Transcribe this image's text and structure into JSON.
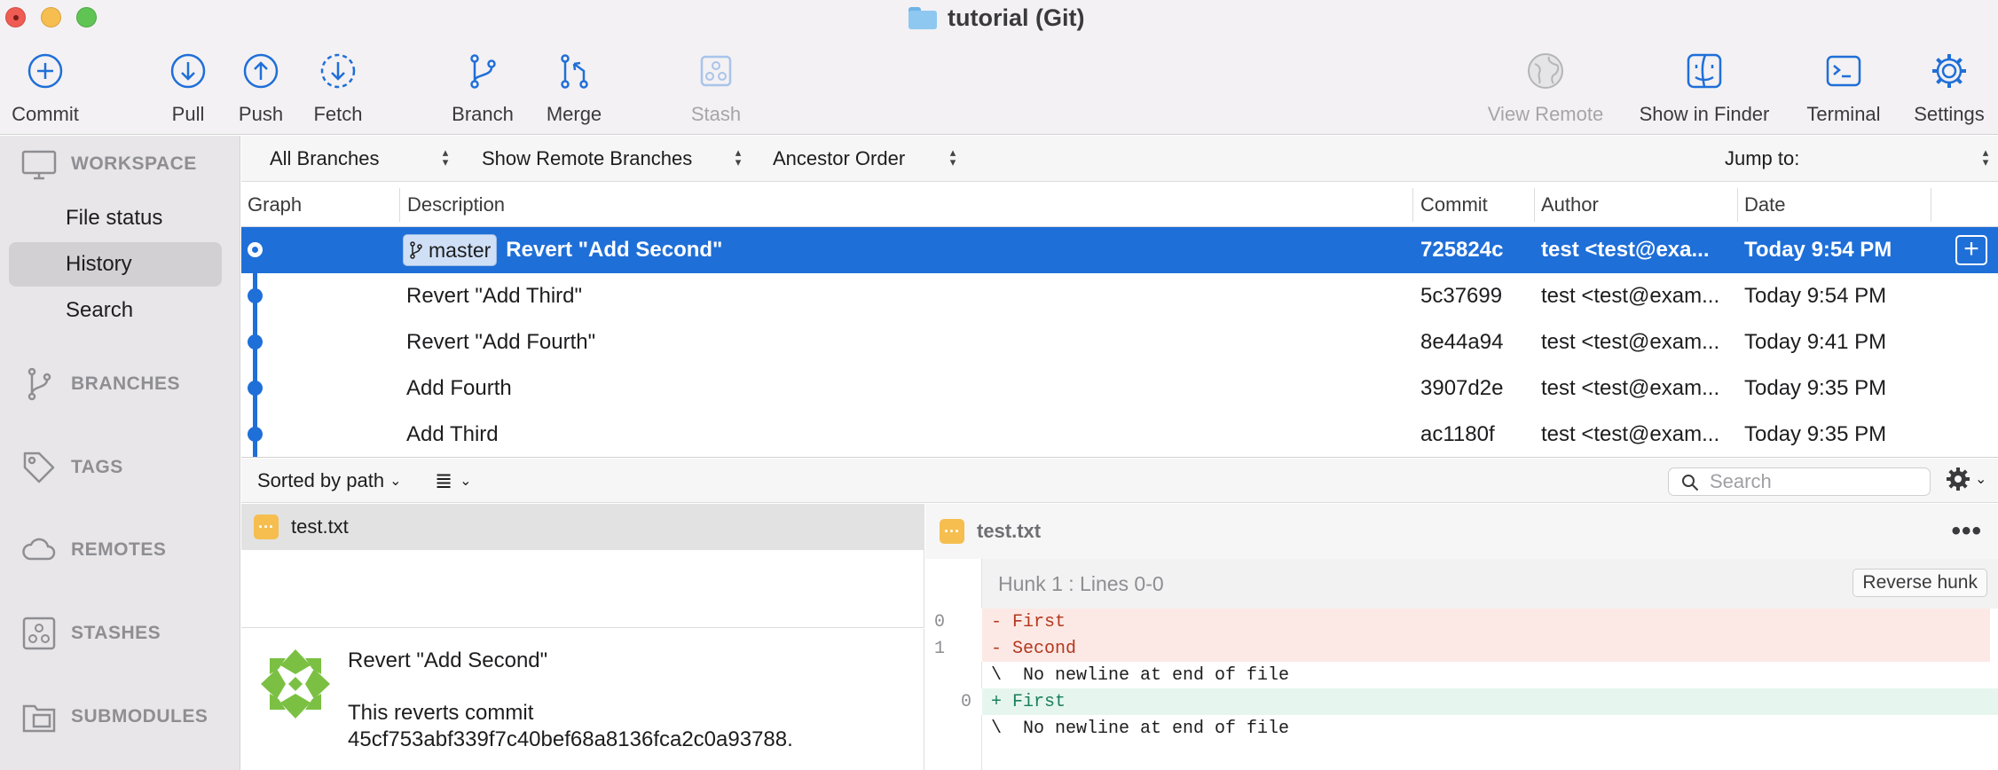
{
  "window": {
    "title": "tutorial (Git)"
  },
  "toolbar": {
    "commit": "Commit",
    "pull": "Pull",
    "push": "Push",
    "fetch": "Fetch",
    "branch": "Branch",
    "merge": "Merge",
    "stash": "Stash",
    "view_remote": "View Remote",
    "show_in_finder": "Show in Finder",
    "terminal": "Terminal",
    "settings": "Settings"
  },
  "sidebar": {
    "workspace": "WORKSPACE",
    "items": [
      {
        "label": "File status"
      },
      {
        "label": "History"
      },
      {
        "label": "Search"
      }
    ],
    "branches": "BRANCHES",
    "tags": "TAGS",
    "remotes": "REMOTES",
    "stashes": "STASHES",
    "submodules": "SUBMODULES"
  },
  "filters": {
    "branches": "All Branches",
    "remote": "Show Remote Branches",
    "order": "Ancestor Order",
    "jump_to": "Jump to:"
  },
  "columns": {
    "graph": "Graph",
    "description": "Description",
    "commit": "Commit",
    "author": "Author",
    "date": "Date"
  },
  "commits": [
    {
      "branch": "master",
      "description": "Revert \"Add Second\"",
      "commit": "725824c",
      "author": "test <test@exa...",
      "date": "Today 9:54 PM"
    },
    {
      "description": "Revert \"Add Third\"",
      "commit": "5c37699",
      "author": "test <test@exam...",
      "date": "Today 9:54 PM"
    },
    {
      "description": "Revert \"Add Fourth\"",
      "commit": "8e44a94",
      "author": "test <test@exam...",
      "date": "Today 9:41 PM"
    },
    {
      "description": "Add Fourth",
      "commit": "3907d2e",
      "author": "test <test@exam...",
      "date": "Today 9:35 PM"
    },
    {
      "description": "Add Third",
      "commit": "ac1180f",
      "author": "test <test@exam...",
      "date": "Today 9:35 PM"
    }
  ],
  "lower": {
    "sort": "Sorted by path",
    "search_placeholder": "Search"
  },
  "files": [
    {
      "name": "test.txt"
    }
  ],
  "commit_message": {
    "title": "Revert \"Add Second\"",
    "body_line1": "This reverts commit",
    "body_line2": "45cf753abf339f7c40bef68a8136fca2c0a93788."
  },
  "diff": {
    "file": "test.txt",
    "hunk": "Hunk 1 : Lines 0-0",
    "reverse_hunk": "Reverse hunk",
    "lines": [
      {
        "old": "0",
        "new": "",
        "text": "- First"
      },
      {
        "old": "1",
        "new": "",
        "text": "- Second"
      },
      {
        "old": "",
        "new": "",
        "text": "\\  No newline at end of file"
      },
      {
        "old": "",
        "new": "0",
        "text": "+ First"
      },
      {
        "old": "",
        "new": "",
        "text": "\\  No newline at end of file"
      }
    ]
  },
  "colors": {
    "accent": "#1f6fd8",
    "deleted": "#b4371e",
    "added": "#1a7f5e",
    "modified": "#f5be4f"
  }
}
